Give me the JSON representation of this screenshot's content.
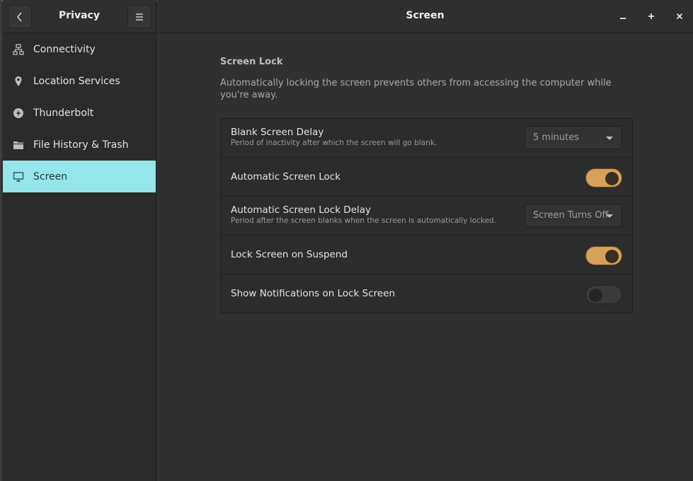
{
  "sidebar": {
    "title": "Privacy",
    "items": [
      {
        "label": "Connectivity",
        "icon": "network-icon"
      },
      {
        "label": "Location Services",
        "icon": "location-pin-icon"
      },
      {
        "label": "Thunderbolt",
        "icon": "thunderbolt-icon"
      },
      {
        "label": "File History & Trash",
        "icon": "folder-icon"
      },
      {
        "label": "Screen",
        "icon": "monitor-icon",
        "active": true
      }
    ]
  },
  "header": {
    "title": "Screen"
  },
  "colors": {
    "accent_active": "#95e6ea",
    "toggle_on": "#d7a05b"
  },
  "screen_lock": {
    "title": "Screen Lock",
    "description": "Automatically locking the screen prevents others from accessing the computer while you're away.",
    "rows": [
      {
        "label": "Blank Screen Delay",
        "sub": "Period of inactivity after which the screen will go blank.",
        "control": "combo",
        "value": "5 minutes"
      },
      {
        "label": "Automatic Screen Lock",
        "control": "toggle",
        "on": true
      },
      {
        "label": "Automatic Screen Lock Delay",
        "sub": "Period after the screen blanks when the screen is automatically locked.",
        "control": "combo",
        "value": "Screen Turns Off"
      },
      {
        "label": "Lock Screen on Suspend",
        "control": "toggle",
        "on": true
      },
      {
        "label": "Show Notifications on Lock Screen",
        "control": "toggle",
        "on": false
      }
    ]
  }
}
